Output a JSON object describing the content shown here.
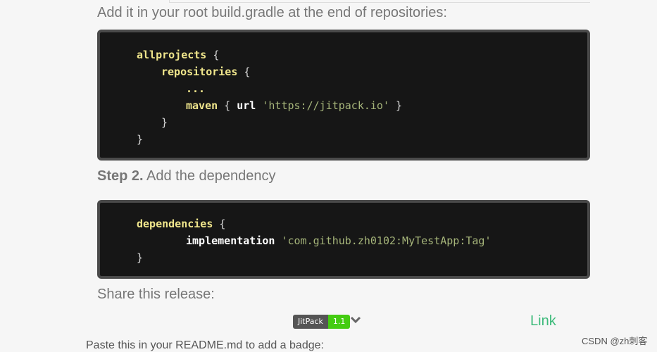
{
  "instructions": {
    "root_gradle": "Add it in your root build.gradle at the end of repositories:",
    "step2_label": "Step 2.",
    "step2_text": " Add the dependency",
    "share": "Share this release:",
    "paste": "Paste this in your README.md to add a badge:"
  },
  "code_block_1": {
    "line1_kw": "allprojects",
    "line1_rest": " {",
    "line2_kw": "repositories",
    "line2_rest": " {",
    "line3": "...",
    "line4_kw": "maven",
    "line4_mid": " { ",
    "line4_id": "url",
    "line4_space": " ",
    "line4_str": "'https://jitpack.io'",
    "line4_end": " }",
    "line5": "}",
    "line6": "}"
  },
  "code_block_2": {
    "line1_kw": "dependencies",
    "line1_rest": " {",
    "line2_id": "implementation",
    "line2_space": " ",
    "line2_str": "'com.github.zh0102:MyTestApp:Tag'",
    "line3": "}"
  },
  "badge": {
    "left": "JitPack",
    "right": "1.1"
  },
  "link_text": "Link",
  "watermark": "CSDN @zh刺客",
  "icons": {
    "chevron": "chevron-down-icon"
  },
  "colors": {
    "code_bg": "#161616",
    "keyword": "#f0e68c",
    "string": "#a6b57a",
    "badge_green": "#44cc11",
    "link": "#3dba7a"
  }
}
